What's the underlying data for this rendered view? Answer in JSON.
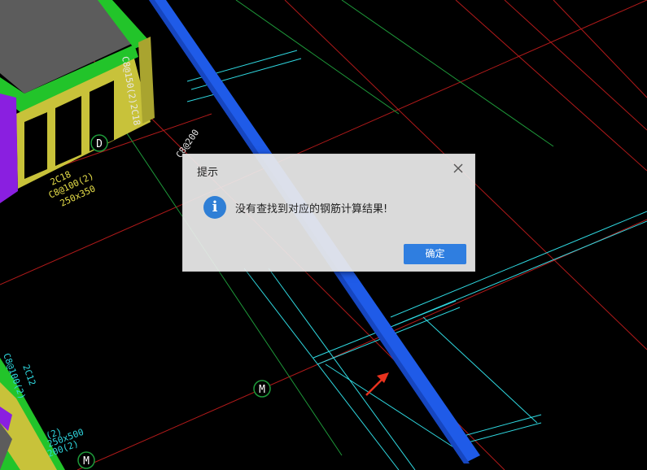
{
  "dialog": {
    "title": "提示",
    "message": "没有查找到对应的钢筋计算结果!",
    "ok_label": "确定",
    "info_glyph": "i",
    "icon": "info-icon",
    "close_icon": "close-icon"
  },
  "cad": {
    "axis_labels": {
      "d": "D",
      "m1": "M",
      "m2": "M"
    },
    "annotations": {
      "a1": "2C18",
      "a2": "C8@100(2)",
      "a3": "250x350",
      "a4": "C8@200",
      "a5": "C8@150(2)2C18",
      "a6": "250x500",
      "a7": "(2)",
      "a8": "200(2)",
      "a9": "2C12",
      "a10": "C8@100(2)"
    }
  },
  "colors": {
    "background": "#000000",
    "beam_blue": "#1f5be8",
    "slab_gray": "#5c5c5c",
    "wall_green": "#22c42a",
    "column_yellow": "#c8c23a",
    "column_purple": "#8a1fe0",
    "grid_red": "#d01f1f",
    "line_cyan": "#2fd8e0",
    "dim_green": "#1e9a3a",
    "button_blue": "#2f7ee0",
    "arrow_red": "#e8321e"
  }
}
